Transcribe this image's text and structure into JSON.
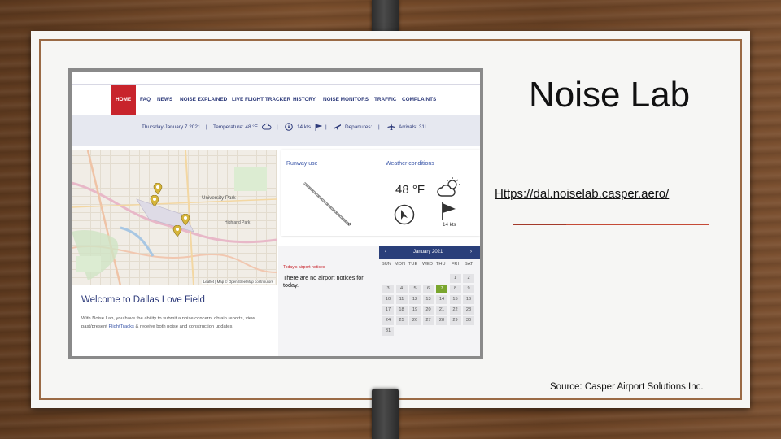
{
  "slide": {
    "title": "Noise Lab",
    "url": "Https://dal.noiselab.casper.aero/",
    "source": "Source: Casper Airport Solutions Inc."
  },
  "website": {
    "nav": [
      "HOME",
      "FAQ",
      "NEWS",
      "NOISE EXPLAINED",
      "LIVE FLIGHT TRACKER",
      "HISTORY",
      "NOISE MONITORS",
      "TRAFFIC",
      "COMPLAINTS"
    ],
    "infobar": {
      "date": "Thursday January 7 2021",
      "temperature": "Temperature: 48 °F",
      "wind": "14 kts",
      "departures": "Departures:",
      "arrivals": "Arrivals: 31L"
    },
    "map": {
      "labels": [
        "University Park",
        "Highland Park"
      ],
      "attribution": "Leaflet | Map © OpenStreetMap contributors"
    },
    "runway_card": {
      "label": "Runway use"
    },
    "weather_card": {
      "label": "Weather conditions",
      "temperature": "48 °F",
      "wind": "14 kts"
    },
    "notices": {
      "label": "Today's airport notices",
      "text": "There are no airport notices for today."
    },
    "calendar": {
      "month": "January 2021",
      "prev": "‹",
      "next": "›",
      "weekdays": [
        "SUN",
        "MON",
        "TUE",
        "WED",
        "THU",
        "FRI",
        "SAT"
      ],
      "weeks": [
        [
          "",
          "",
          "",
          "",
          "",
          "1",
          "2"
        ],
        [
          "3",
          "4",
          "5",
          "6",
          "7",
          "8",
          "9"
        ],
        [
          "10",
          "11",
          "12",
          "13",
          "14",
          "15",
          "16"
        ],
        [
          "17",
          "18",
          "19",
          "20",
          "21",
          "22",
          "23"
        ],
        [
          "24",
          "25",
          "26",
          "27",
          "28",
          "29",
          "30"
        ],
        [
          "31",
          "",
          "",
          "",
          "",
          "",
          ""
        ]
      ],
      "today": "7"
    },
    "welcome": {
      "title": "Welcome to Dallas Love Field",
      "body_a": "With Noise Lab, you have the ability to submit a noise concern, obtain reports, view past/present ",
      "body_link": "FlightTracks",
      "body_b": " & receive both noise and construction updates."
    }
  }
}
